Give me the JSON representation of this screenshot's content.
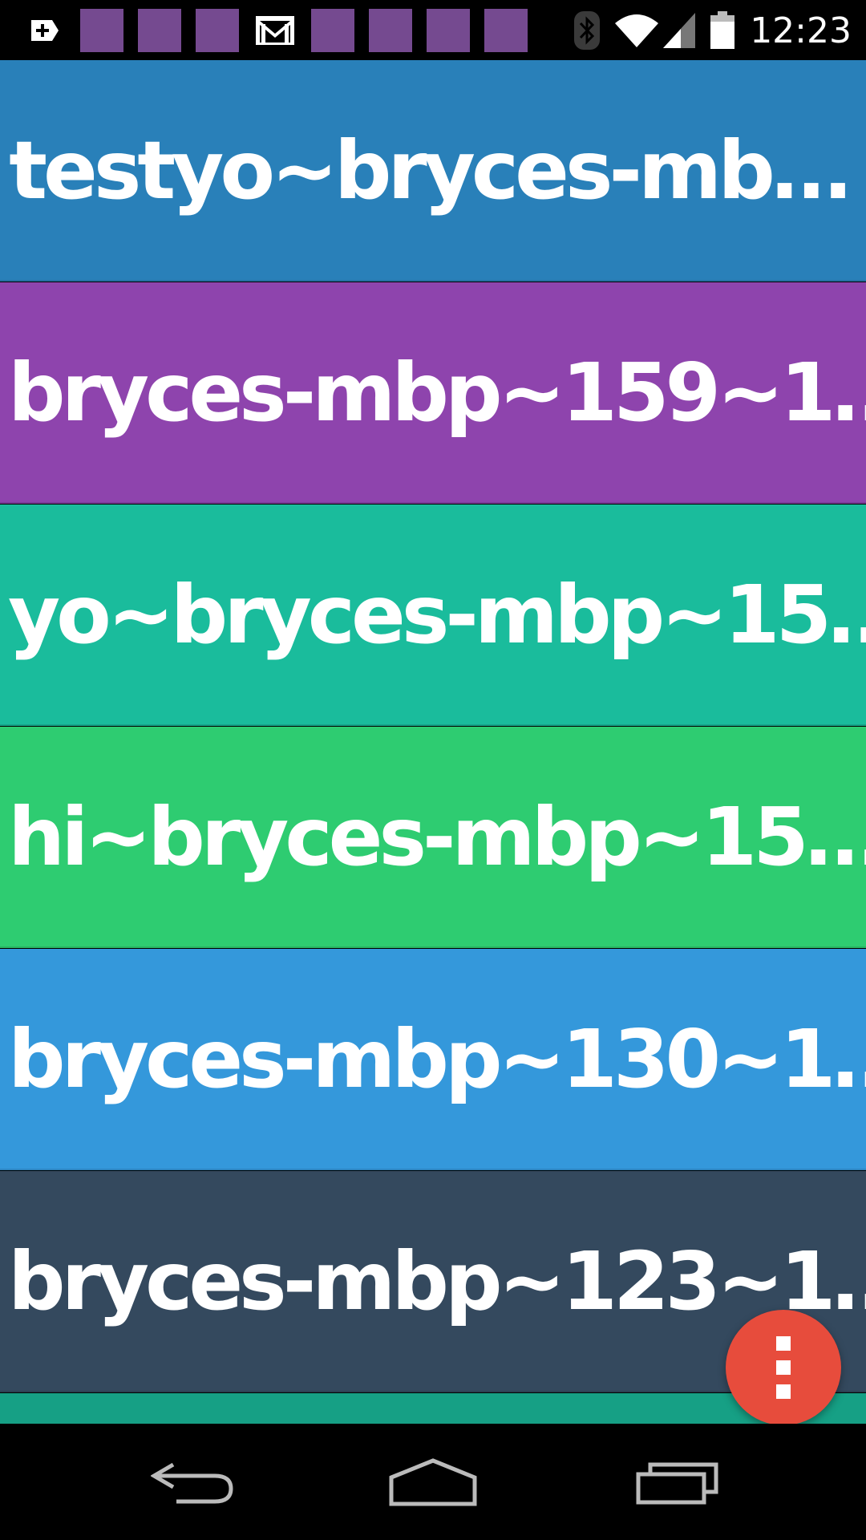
{
  "status_bar": {
    "time": "12:23",
    "notification_icons": [
      "add-icon",
      "app-square",
      "app-square",
      "app-square",
      "gmail-icon",
      "app-square",
      "app-square",
      "app-square",
      "app-square"
    ],
    "system_icons": [
      "bluetooth-icon",
      "wifi-icon",
      "signal-icon",
      "battery-icon"
    ]
  },
  "list": {
    "items": [
      {
        "label": "testyo~bryces-mb…",
        "color": "#2980b9"
      },
      {
        "label": "bryces-mbp~159~1…",
        "color": "#8e44ad"
      },
      {
        "label": "yo~bryces-mbp~15…",
        "color": "#1abc9c"
      },
      {
        "label": "hi~bryces-mbp~15…",
        "color": "#2ecc71"
      },
      {
        "label": "bryces-mbp~130~1…",
        "color": "#3498db"
      },
      {
        "label": "bryces-mbp~123~1…",
        "color": "#34495e"
      },
      {
        "label": "",
        "color": "#16a085"
      }
    ]
  },
  "fab": {
    "icon": "more-vert-icon",
    "color": "#e74c3c"
  },
  "nav_bar": {
    "buttons": [
      "back-icon",
      "home-icon",
      "recents-icon"
    ]
  }
}
